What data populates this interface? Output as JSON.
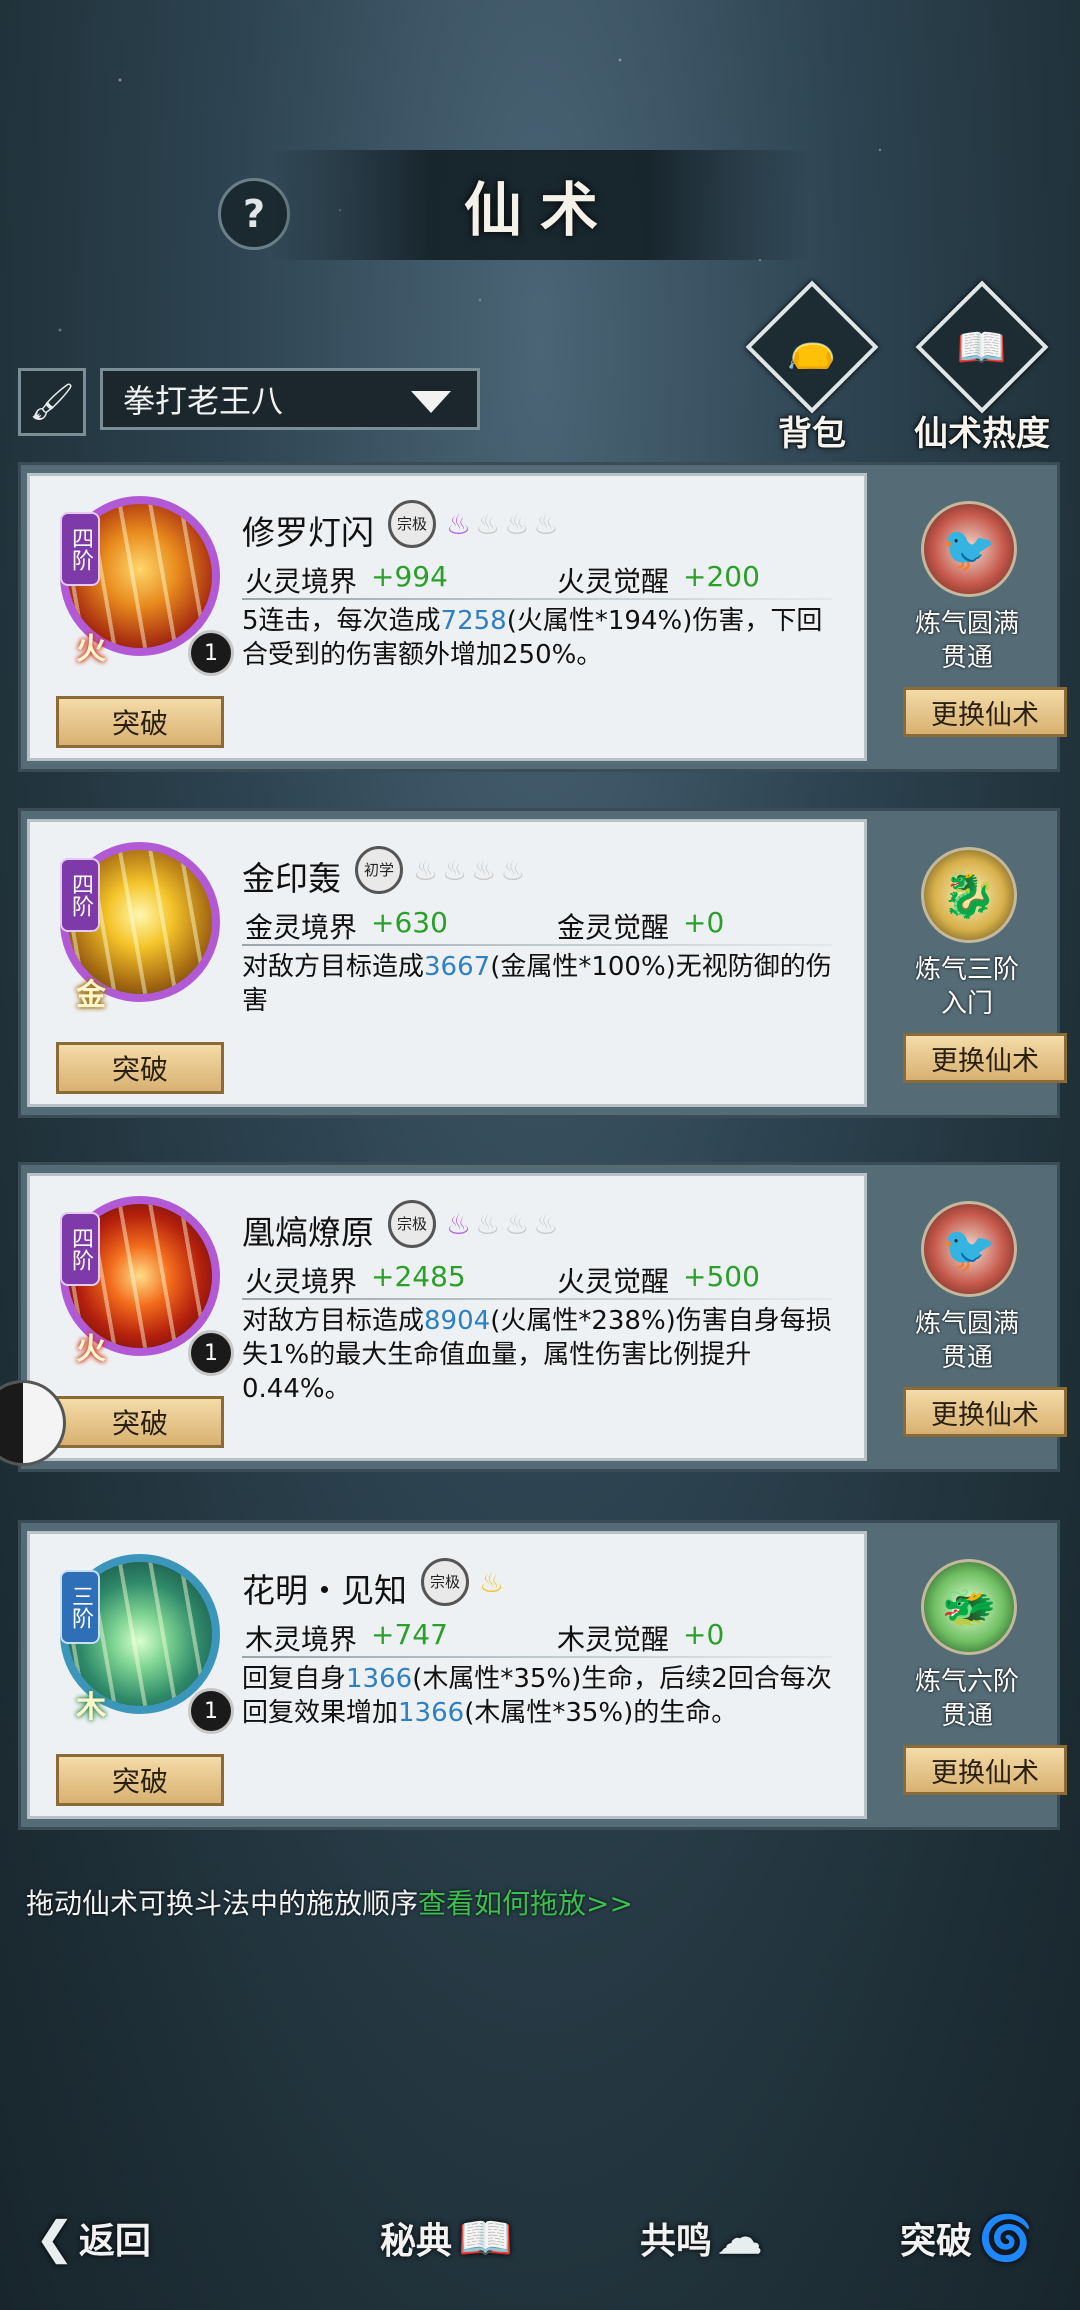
{
  "header": {
    "title": "仙术",
    "help_icon": "question-icon"
  },
  "top_icons": [
    {
      "label": "背包",
      "icon": "bag-icon"
    },
    {
      "label": "仙术热度",
      "icon": "book-flame-icon"
    }
  ],
  "selector": {
    "value": "拳打老王八",
    "icon": "brush-icon"
  },
  "skills": [
    {
      "tier": "四阶",
      "tier_color": "#7d3aa8",
      "element": "火",
      "level": "1",
      "name": "修罗灯闪",
      "rank": "宗极",
      "flames_on": 1,
      "flames_total": 4,
      "flame_color": "#b665e6",
      "stat1_label": "火灵境界",
      "stat1_value": "+994",
      "stat2_label": "火灵觉醒",
      "stat2_value": "+200",
      "desc_pre": "5连击，每次造成",
      "desc_num1": "7258",
      "desc_mid": "(火属性*194%)伤害，下回合受到的伤害额外增加250%。",
      "desc_num2": "",
      "desc_post": "",
      "break_label": "突破",
      "side_emblem": "phoenix-icon",
      "side_realm": "炼气圆满\n贯通",
      "swap_label": "更换仙术"
    },
    {
      "tier": "四阶",
      "tier_color": "#7d3aa8",
      "element": "金",
      "level": "",
      "name": "金印轰",
      "rank": "初学",
      "flames_on": 0,
      "flames_total": 4,
      "flame_color": "#c9c9c9",
      "stat1_label": "金灵境界",
      "stat1_value": "+630",
      "stat2_label": "金灵觉醒",
      "stat2_value": "+0",
      "desc_pre": "对敌方目标造成",
      "desc_num1": "3667",
      "desc_mid": "(金属性*100%)无视防御的伤害",
      "desc_num2": "",
      "desc_post": "",
      "break_label": "突破",
      "side_emblem": "qilin-icon",
      "side_realm": "炼气三阶\n入门",
      "swap_label": "更换仙术"
    },
    {
      "tier": "四阶",
      "tier_color": "#7d3aa8",
      "element": "火",
      "level": "1",
      "name": "凰熇燎原",
      "rank": "宗极",
      "flames_on": 1,
      "flames_total": 4,
      "flame_color": "#b665e6",
      "stat1_label": "火灵境界",
      "stat1_value": "+2485",
      "stat2_label": "火灵觉醒",
      "stat2_value": "+500",
      "desc_pre": "对敌方目标造成",
      "desc_num1": "8904",
      "desc_mid": "(火属性*238%)伤害自身每损失1%的最大生命值血量，属性伤害比例提升0.44%。",
      "desc_num2": "",
      "desc_post": "",
      "break_label": "突破",
      "side_emblem": "phoenix-icon",
      "side_realm": "炼气圆满\n贯通",
      "swap_label": "更换仙术"
    },
    {
      "tier": "三阶",
      "tier_color": "#2f6fb8",
      "element": "木",
      "level": "1",
      "name": "花明・见知",
      "rank": "宗极",
      "flames_on": 1,
      "flames_total": 1,
      "flame_color": "#f3c227",
      "stat1_label": "木灵境界",
      "stat1_value": "+747",
      "stat2_label": "木灵觉醒",
      "stat2_value": "+0",
      "desc_pre": "回复自身",
      "desc_num1": "1366",
      "desc_mid": "(木属性*35%)生命，后续2回合每次回复效果增加",
      "desc_num2": "1366",
      "desc_post": "(木属性*35%)的生命。",
      "break_label": "突破",
      "side_emblem": "dragon-icon",
      "side_realm": "炼气六阶\n贯通",
      "swap_label": "更换仙术"
    }
  ],
  "hint": {
    "text": "拖动仙术可换斗法中的施放顺序",
    "link": "查看如何拖放>>"
  },
  "bottom_nav": [
    {
      "label": "返回",
      "icon": "back-arrow-icon"
    },
    {
      "label": "秘典",
      "icon": "book-icon"
    },
    {
      "label": "共鸣",
      "icon": "cloud-icon"
    },
    {
      "label": "突破",
      "icon": "swirl-icon"
    }
  ]
}
